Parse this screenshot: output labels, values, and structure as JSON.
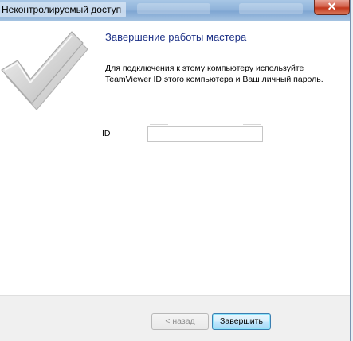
{
  "window": {
    "title": "Неконтролируемый доступ",
    "close_icon": "close-icon"
  },
  "main": {
    "icon": "checkmark-icon",
    "heading": "Завершение работы мастера",
    "description": "Для подключения к этому компьютеру используйте TeamViewer ID этого компьютера и Ваш личный пароль.",
    "id_label": "ID",
    "id_value": ""
  },
  "footer": {
    "back_label": "< назад",
    "finish_label": "Завершить"
  },
  "colors": {
    "heading": "#1e3287",
    "footer_bg": "#f0f0f0",
    "default_button_border": "#3c7fb1"
  }
}
